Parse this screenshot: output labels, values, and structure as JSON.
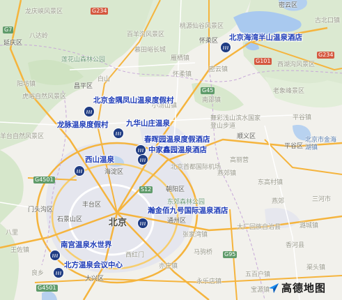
{
  "place_labels": [
    {
      "id": "longqing",
      "text": "龙庆峡风景区"
    },
    {
      "id": "g234_top",
      "text": "G234"
    },
    {
      "id": "g7",
      "text": "G7"
    },
    {
      "id": "yanqing",
      "text": "延庆区"
    },
    {
      "id": "badaling",
      "text": "八达岭"
    },
    {
      "id": "lianhuashan",
      "text": "莲花山森林公园"
    },
    {
      "id": "baiyang",
      "text": "百羊沟风景区"
    },
    {
      "id": "mutianyu",
      "text": "慕田峪长城"
    },
    {
      "id": "taolin",
      "text": "桃源仙谷风景区"
    },
    {
      "id": "miyun",
      "text": "密云区"
    },
    {
      "id": "huairou",
      "text": "怀柔区"
    },
    {
      "id": "yanqi",
      "text": "雁栖镇"
    },
    {
      "id": "g234_right",
      "text": "G234"
    },
    {
      "id": "g101",
      "text": "G101"
    },
    {
      "id": "yanghuxian",
      "text": "西湖沟风景区"
    },
    {
      "id": "huairou_town",
      "text": "怀柔镇"
    },
    {
      "id": "miyun_town",
      "text": "密云镇"
    },
    {
      "id": "gubeikou",
      "text": "古北口镇"
    },
    {
      "id": "huliangsi",
      "text": "虎峪自然风景区"
    },
    {
      "id": "yangfang",
      "text": "阳坊镇"
    },
    {
      "id": "changping",
      "text": "昌平区"
    },
    {
      "id": "baishan",
      "text": "白山"
    },
    {
      "id": "nanshao",
      "text": "南邵镇"
    },
    {
      "id": "xiaotangshan",
      "text": "小汤山镇"
    },
    {
      "id": "g45",
      "text": "G45"
    },
    {
      "id": "wufengshan",
      "text": "舞彩浅山滨水国家登山步道"
    },
    {
      "id": "pinggu",
      "text": "平谷镇"
    },
    {
      "id": "laoshan",
      "text": "老象峰景区"
    },
    {
      "id": "shunyi",
      "text": "顺义区"
    },
    {
      "id": "pinggu_district",
      "text": "平谷区"
    },
    {
      "id": "jinhaihu",
      "text": "北京市金海湖镇"
    },
    {
      "id": "shunyi_capital",
      "text": "北京首都国际机场"
    },
    {
      "id": "shaqi",
      "text": "羊台自然风景区"
    },
    {
      "id": "haidian",
      "text": "海淀区"
    },
    {
      "id": "g4501_left",
      "text": "G4501"
    },
    {
      "id": "sanhe",
      "text": "三河市"
    },
    {
      "id": "yanjiao",
      "text": "燕郊"
    },
    {
      "id": "s12",
      "text": "S12"
    },
    {
      "id": "dongjiao",
      "text": "东郊森林公园"
    },
    {
      "id": "yicheng",
      "text": "燕郊镇"
    },
    {
      "id": "chaoyang",
      "text": "朝阳区"
    },
    {
      "id": "beijing",
      "text": "北京"
    },
    {
      "id": "shijingshan",
      "text": "石景山区"
    },
    {
      "id": "mentougou",
      "text": "门头沟区"
    },
    {
      "id": "fengtai",
      "text": "丰台区"
    },
    {
      "id": "tongzhou",
      "text": "通州区"
    },
    {
      "id": "yanjiao2",
      "text": "大厂回族自治县"
    },
    {
      "id": "zhangjiawan",
      "text": "张家湾镇"
    },
    {
      "id": "lucheng",
      "text": "潞城镇"
    },
    {
      "id": "xianghe",
      "text": "香河县"
    },
    {
      "id": "daxing",
      "text": "大兴区"
    },
    {
      "id": "g95",
      "text": "G95"
    },
    {
      "id": "yizhuang",
      "text": "亦庄镇"
    },
    {
      "id": "g4501_bottom",
      "text": "G4501"
    },
    {
      "id": "wuyi",
      "text": "五百户镇"
    },
    {
      "id": "liangxiang",
      "text": "良乡"
    },
    {
      "id": "yongle",
      "text": "永乐店镇"
    },
    {
      "id": "bajia",
      "text": "八里"
    },
    {
      "id": "yanjiao3",
      "text": "马驹桥"
    },
    {
      "id": "xihongmen",
      "text": "西红门"
    },
    {
      "id": "yufa",
      "text": "渠头镇"
    },
    {
      "id": "wangzuo",
      "text": "王佐镇"
    },
    {
      "id": "baiyuan",
      "text": "宝源镇"
    },
    {
      "id": "dongpan",
      "text": "东高村镇"
    },
    {
      "id": "gaoliying",
      "text": "高丽营"
    }
  ],
  "pois": [
    {
      "id": "haiwan",
      "name": "北京海湾半山温泉酒店"
    },
    {
      "id": "jinyu",
      "name": "北京金隅凤山温泉度假村"
    },
    {
      "id": "longmai",
      "name": "龙脉温泉度假村"
    },
    {
      "id": "jiuhua",
      "name": "九华山庄温泉"
    },
    {
      "id": "chunhui",
      "name": "春晖园温泉度假酒店"
    },
    {
      "id": "zhongjia",
      "name": "中家鑫园温泉酒店"
    },
    {
      "id": "xishan",
      "name": "西山温泉"
    },
    {
      "id": "tianxin",
      "name": "瀚金佰九号国际温泉酒店"
    },
    {
      "id": "nangong",
      "name": "南宫温泉水世界"
    },
    {
      "id": "beifang",
      "name": "北方温泉会议中心"
    }
  ],
  "logo": {
    "text": "高德地图",
    "icon": "navigation-arrow-icon"
  },
  "colors": {
    "poi_text": "#1d3bb7",
    "poi_icon": "#1f3c83",
    "urban": "#e4e6ef",
    "water": "#a9c9ef",
    "highway": "#f5b43d",
    "forest": "#cfe3c5"
  }
}
